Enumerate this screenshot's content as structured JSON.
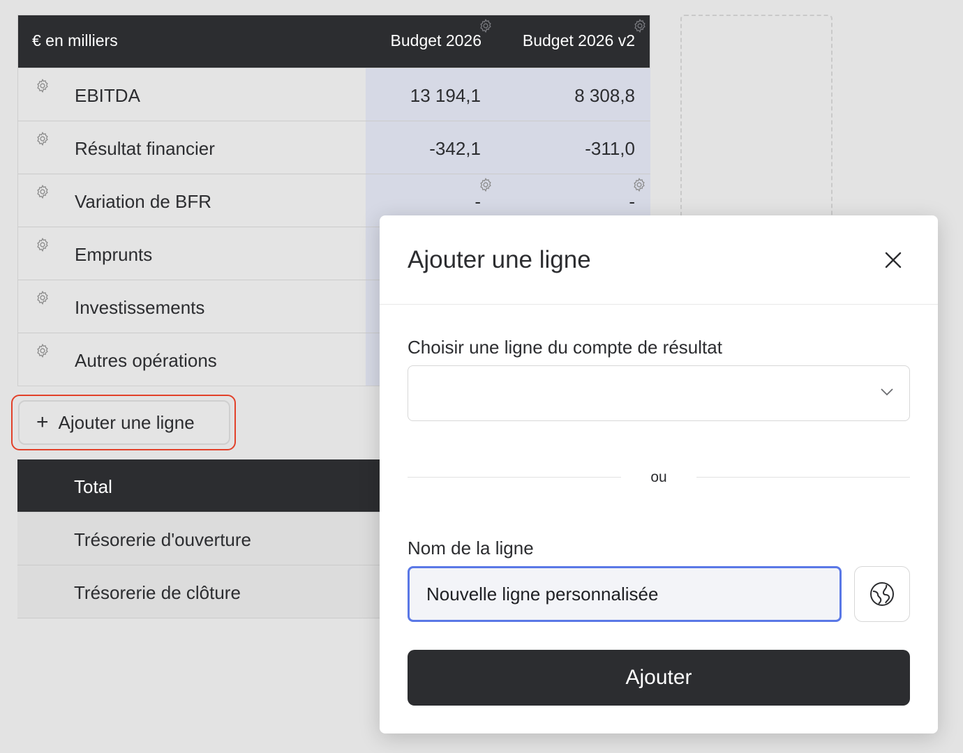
{
  "table": {
    "unit_label": "€ en milliers",
    "columns": [
      "Budget 2026",
      "Budget 2026 v2"
    ],
    "rows": [
      {
        "label": "EBITDA",
        "v1": "13 194,1",
        "v2": "8 308,8"
      },
      {
        "label": "Résultat financier",
        "v1": "-342,1",
        "v2": "-311,0"
      },
      {
        "label": "Variation de BFR",
        "v1": "-",
        "v2": "-"
      },
      {
        "label": "Emprunts",
        "v1": "",
        "v2": ""
      },
      {
        "label": "Investissements",
        "v1": "",
        "v2": ""
      },
      {
        "label": "Autres opérations",
        "v1": "",
        "v2": ""
      }
    ]
  },
  "add_row_button": {
    "label": "Ajouter une ligne"
  },
  "bottom_rows": [
    {
      "label": "Total"
    },
    {
      "label": "Trésorerie d'ouverture"
    },
    {
      "label": "Trésorerie de clôture"
    }
  ],
  "modal": {
    "title": "Ajouter une ligne",
    "select_label": "Choisir une ligne du compte de résultat",
    "select_value": "",
    "separator": "ou",
    "name_label": "Nom de la ligne",
    "name_value": "Nouvelle ligne personnalisée",
    "submit_label": "Ajouter"
  },
  "icons": {
    "gear": "gear-icon",
    "close": "close-icon",
    "chevron": "chevron-down-icon",
    "globe": "globe-icon",
    "plus": "plus-icon"
  },
  "colors": {
    "header_bg": "#2c2d30",
    "value_col_bg": "#d6d9e5",
    "highlight_border": "#e2412a",
    "input_focus": "#5a78e6"
  }
}
